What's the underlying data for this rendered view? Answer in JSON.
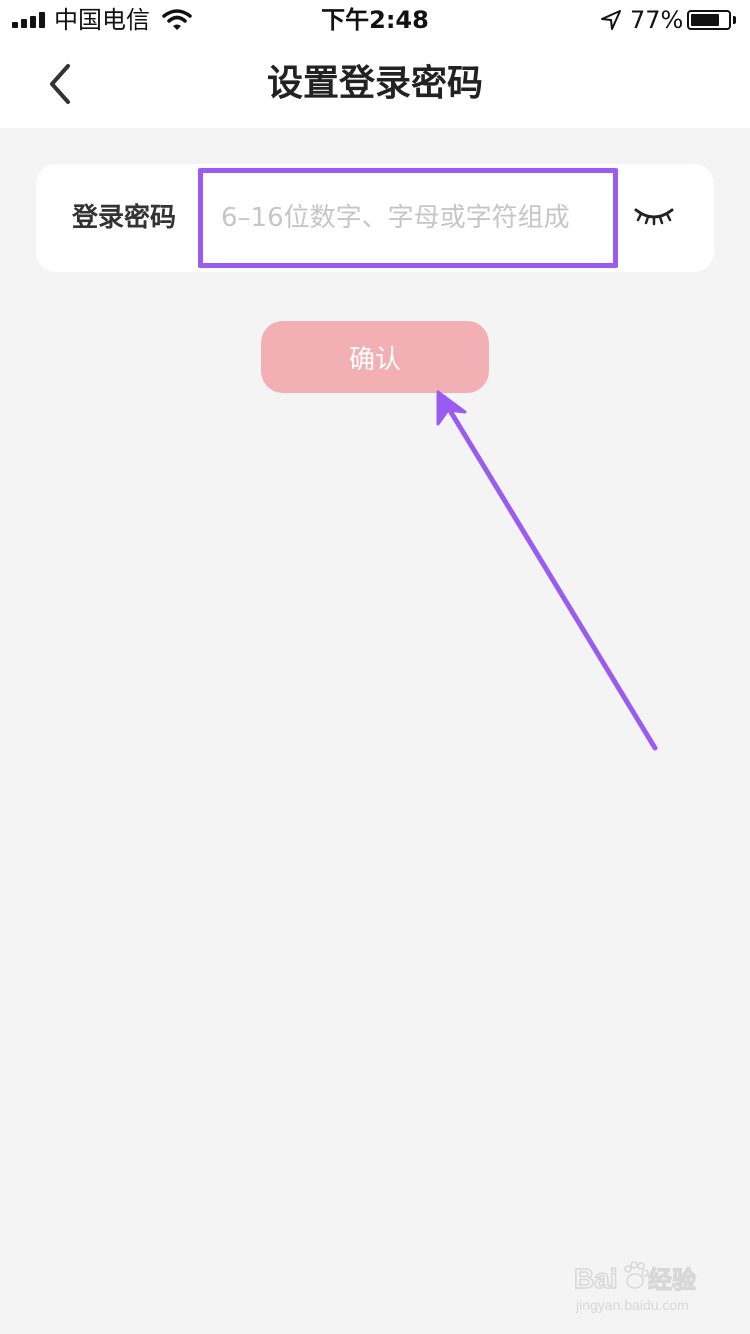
{
  "status_bar": {
    "carrier": "中国电信",
    "time": "下午2:48",
    "battery_percent": "77%",
    "battery_level": 0.77,
    "icons": [
      "signal-icon",
      "wifi-icon",
      "location-arrow-icon",
      "battery-icon"
    ]
  },
  "nav": {
    "back_icon": "chevron-left-icon",
    "title": "设置登录密码"
  },
  "form": {
    "password_label": "登录密码",
    "password_placeholder": "6–16位数字、字母或字符组成",
    "password_value": "",
    "toggle_icon": "eye-closed-icon"
  },
  "actions": {
    "confirm_label": "确认"
  },
  "annotation": {
    "highlight_color": "#9a5cf0",
    "arrow_color": "#9a5cf0"
  },
  "colors": {
    "confirm_button_bg": "#f3b0b4",
    "page_bg": "#f4f4f4"
  },
  "watermark": {
    "brand": "Bai",
    "suffix": "经验",
    "url": "jingyan.baidu.com"
  }
}
